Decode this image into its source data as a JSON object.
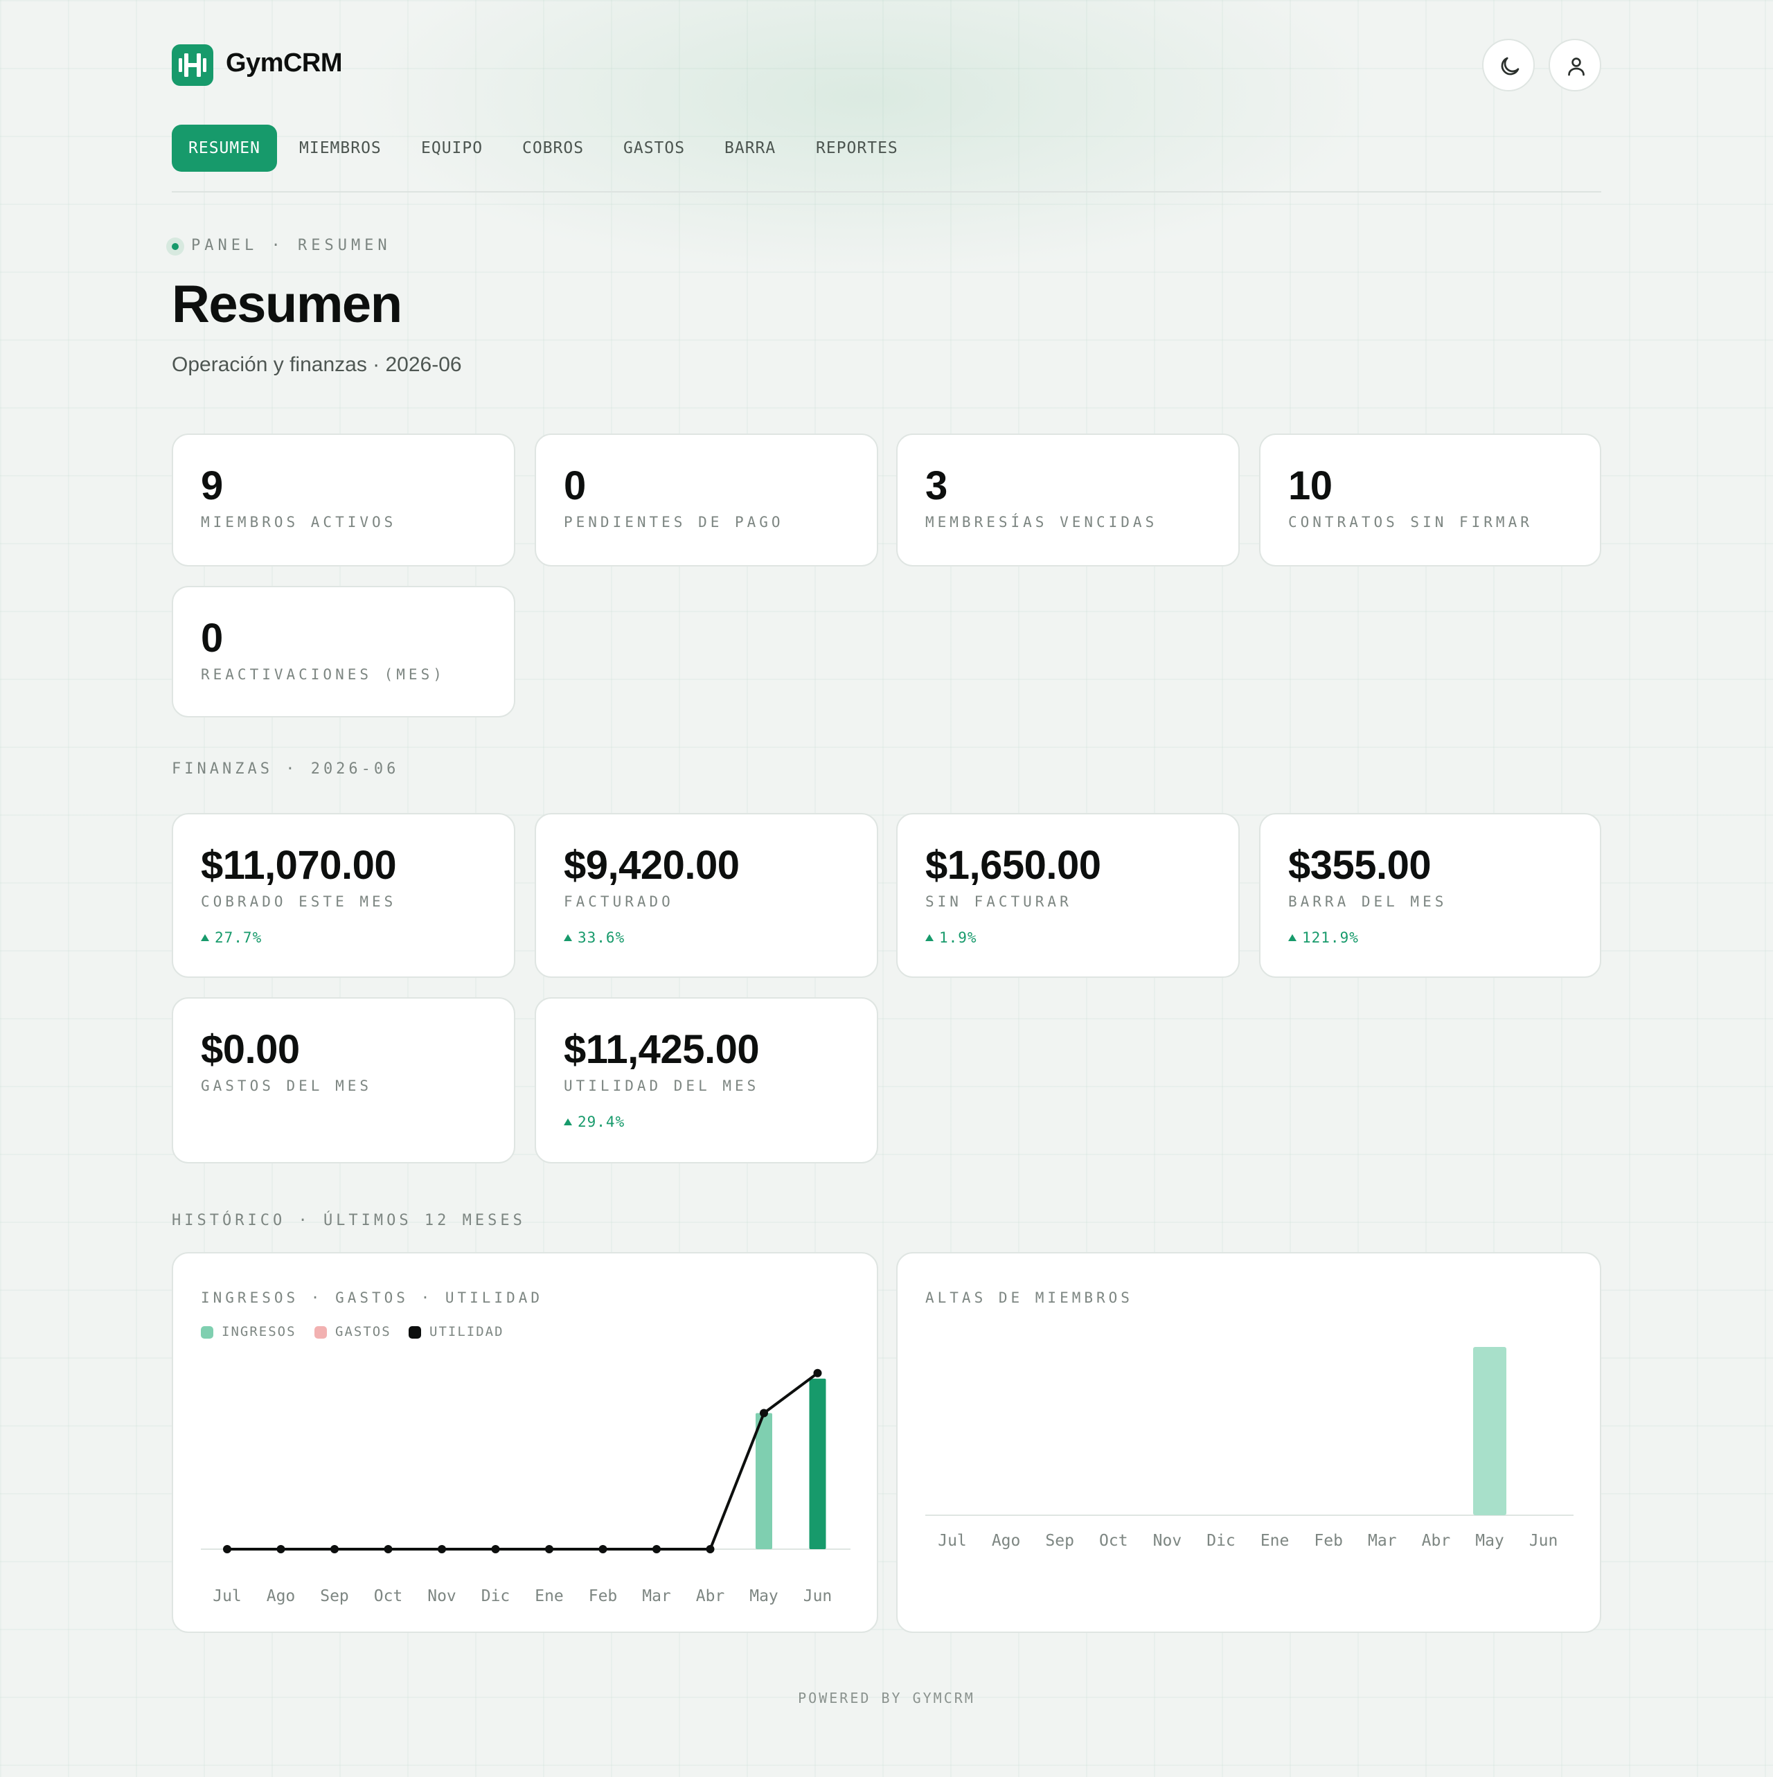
{
  "app": {
    "brand": "GymCRM"
  },
  "nav": {
    "tabs": [
      {
        "label": "RESUMEN",
        "active": true
      },
      {
        "label": "MIEMBROS",
        "active": false
      },
      {
        "label": "EQUIPO",
        "active": false
      },
      {
        "label": "COBROS",
        "active": false
      },
      {
        "label": "GASTOS",
        "active": false
      },
      {
        "label": "BARRA",
        "active": false
      },
      {
        "label": "REPORTES",
        "active": false
      }
    ]
  },
  "header": {
    "theme_icon": "moon-icon",
    "user_icon": "user-icon"
  },
  "breadcrumb": "PANEL · RESUMEN",
  "page": {
    "title": "Resumen",
    "subtitle": "Operación y finanzas · 2026-06"
  },
  "kpis": [
    {
      "value": "9",
      "label": "MIEMBROS ACTIVOS"
    },
    {
      "value": "0",
      "label": "PENDIENTES DE PAGO"
    },
    {
      "value": "3",
      "label": "MEMBRESÍAS VENCIDAS"
    },
    {
      "value": "10",
      "label": "CONTRATOS SIN FIRMAR"
    },
    {
      "value": "0",
      "label": "REACTIVACIONES (MES)"
    }
  ],
  "finance": {
    "section_label": "FINANZAS · 2026-06",
    "cards": [
      {
        "value": "$11,070.00",
        "label": "COBRADO ESTE MES",
        "delta": "27.7%"
      },
      {
        "value": "$9,420.00",
        "label": "FACTURADO",
        "delta": "33.6%"
      },
      {
        "value": "$1,650.00",
        "label": "SIN FACTURAR",
        "delta": "1.9%"
      },
      {
        "value": "$355.00",
        "label": "BARRA DEL MES",
        "delta": "121.9%"
      },
      {
        "value": "$0.00",
        "label": "GASTOS DEL MES",
        "delta": ""
      },
      {
        "value": "$11,425.00",
        "label": "UTILIDAD DEL MES",
        "delta": "29.4%"
      }
    ]
  },
  "history": {
    "section_label": "HISTÓRICO · ÚLTIMOS 12 MESES"
  },
  "colors": {
    "accent": "#179a6b",
    "ingresos": "#7fcfb0",
    "gastos": "#f2b1b1",
    "utilidad": "#0d0f0e",
    "altas": "#a8e0ca"
  },
  "chart_data": [
    {
      "type": "bar",
      "title": "INGRESOS · GASTOS · UTILIDAD",
      "categories": [
        "Jul",
        "Ago",
        "Sep",
        "Oct",
        "Nov",
        "Dic",
        "Ene",
        "Feb",
        "Mar",
        "Abr",
        "May",
        "Jun"
      ],
      "legend": [
        "INGRESOS",
        "GASTOS",
        "UTILIDAD"
      ],
      "series": [
        {
          "name": "INGRESOS",
          "kind": "bar",
          "values": [
            0,
            0,
            0,
            0,
            0,
            0,
            0,
            0,
            0,
            0,
            8830,
            11070
          ]
        },
        {
          "name": "GASTOS",
          "kind": "bar",
          "values": [
            0,
            0,
            0,
            0,
            0,
            0,
            0,
            0,
            0,
            0,
            0,
            0
          ]
        },
        {
          "name": "UTILIDAD",
          "kind": "line",
          "values": [
            0,
            0,
            0,
            0,
            0,
            0,
            0,
            0,
            0,
            0,
            8830,
            11425
          ]
        }
      ],
      "ylim": [
        0,
        12000
      ],
      "grid": false
    },
    {
      "type": "bar",
      "title": "ALTAS DE MIEMBROS",
      "categories": [
        "Jul",
        "Ago",
        "Sep",
        "Oct",
        "Nov",
        "Dic",
        "Ene",
        "Feb",
        "Mar",
        "Abr",
        "May",
        "Jun"
      ],
      "values": [
        0,
        0,
        0,
        0,
        0,
        0,
        0,
        0,
        0,
        0,
        9,
        0
      ],
      "ylim": [
        0,
        10
      ],
      "grid": false
    }
  ],
  "footer": "POWERED BY GYMCRM"
}
